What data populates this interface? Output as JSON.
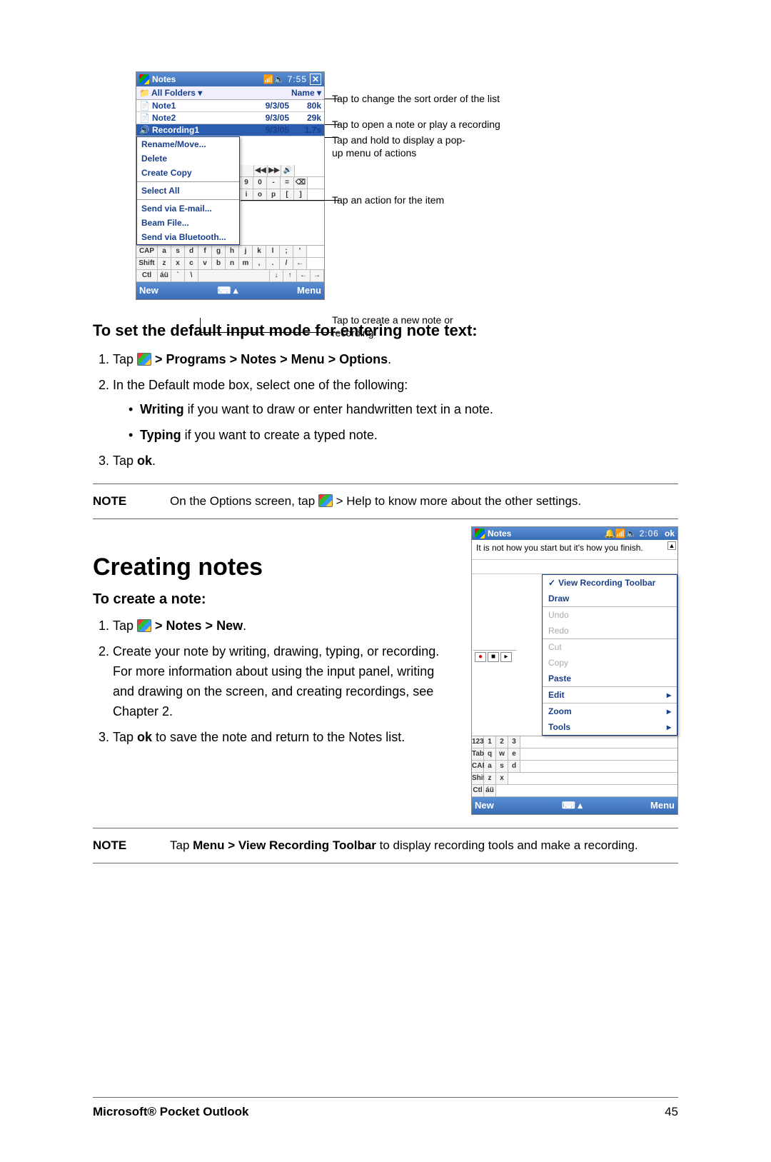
{
  "shot1": {
    "title": "Notes",
    "time": "7:55",
    "folders": "All Folders",
    "sort_col": "Name",
    "rows": [
      {
        "icon": "📄",
        "name": "Note1",
        "date": "9/3/05",
        "size": "80k"
      },
      {
        "icon": "📄",
        "name": "Note2",
        "date": "9/3/05",
        "size": "29k"
      },
      {
        "icon": "🔊",
        "name": "Recording1",
        "date": "9/3/05",
        "size": "1.7s"
      }
    ],
    "popup": [
      "Rename/Move...",
      "Delete",
      "Create Copy",
      "Select All",
      "Send via E-mail...",
      "Beam File...",
      "Send via Bluetooth..."
    ],
    "soft_new": "New",
    "soft_menu": "Menu"
  },
  "callouts": {
    "c1": "Tap to change the sort order of the list",
    "c2": "Tap to open a note or play a recording",
    "c3": "Tap and hold to display a pop-up menu of actions",
    "c4": "Tap an action for the item",
    "c5": "Tap to create a new note or recording"
  },
  "section1": {
    "heading": "To set the default input mode for entering note text:",
    "step1_a": "Tap ",
    "step1_b": " > Programs > Notes > Menu > Options",
    "step2": "In the Default mode box, select one of the following:",
    "bullet1_b": "Writing",
    "bullet1_r": " if you want to draw or enter handwritten text in a note.",
    "bullet2_b": "Typing",
    "bullet2_r": " if you want to create a typed note.",
    "step3_a": "Tap ",
    "step3_b": "ok",
    "note_label": "NOTE",
    "note_a": "On the Options screen, tap ",
    "note_b": " > Help to know more about the other settings."
  },
  "heading_main": "Creating notes",
  "section2": {
    "heading": "To create a note:",
    "step1_a": "Tap ",
    "step1_b": " > Notes > New",
    "step2": "Create your note by writing, drawing, typing, or recording. For more information about using the input panel, writing and drawing on the screen, and creating recordings, see Chapter 2.",
    "step3_a": "Tap ",
    "step3_b": "ok",
    "step3_c": " to save the note and  return to the Notes list.",
    "note_label": "NOTE",
    "note_a": "Tap ",
    "note_b": "Menu > View Recording Toolbar",
    "note_c": " to display recording tools and make a recording."
  },
  "shot2": {
    "title": "Notes",
    "time": "2:06",
    "ok": "ok",
    "notetext": "It is not how you start but it's how you finish.",
    "menu": [
      {
        "label": "View Recording Toolbar",
        "check": true
      },
      {
        "label": "Draw"
      },
      {
        "label": "Undo",
        "dis": true
      },
      {
        "label": "Redo",
        "dis": true
      },
      {
        "label": "Cut",
        "dis": true
      },
      {
        "label": "Copy",
        "dis": true
      },
      {
        "label": "Paste"
      },
      {
        "label": "Edit",
        "arr": true
      },
      {
        "label": "Zoom",
        "arr": true
      },
      {
        "label": "Tools",
        "arr": true
      }
    ],
    "soft_new": "New",
    "soft_menu": "Menu"
  },
  "kb1": [
    [
      "CAP",
      "a",
      "s",
      "d",
      "f",
      "g",
      "h",
      "j",
      "k",
      "l",
      ";",
      "'"
    ],
    [
      "Shift",
      "z",
      "x",
      "c",
      "v",
      "b",
      "n",
      "m",
      ",",
      ".",
      "/",
      "←"
    ],
    [
      "Ctl",
      "áü",
      "`",
      "\\",
      "",
      "",
      "",
      "",
      "↓",
      "↑",
      "←",
      "→"
    ]
  ],
  "kb1_top_right": [
    [
      "⇦",
      "◀◀",
      "▶▶",
      "🔊"
    ],
    [
      "9",
      "0",
      "-",
      "=",
      "⌫"
    ],
    [
      "i",
      "o",
      "p",
      "[",
      "]"
    ]
  ],
  "kb2": [
    [
      "123",
      "1",
      "2",
      "3"
    ],
    [
      "Tab",
      "q",
      "w",
      "e"
    ],
    [
      "CAP",
      "a",
      "s",
      "d"
    ],
    [
      "Shift",
      "z",
      "x"
    ],
    [
      "Ctl",
      "áü"
    ]
  ],
  "footer": {
    "title": "Microsoft® Pocket Outlook",
    "page": "45"
  }
}
